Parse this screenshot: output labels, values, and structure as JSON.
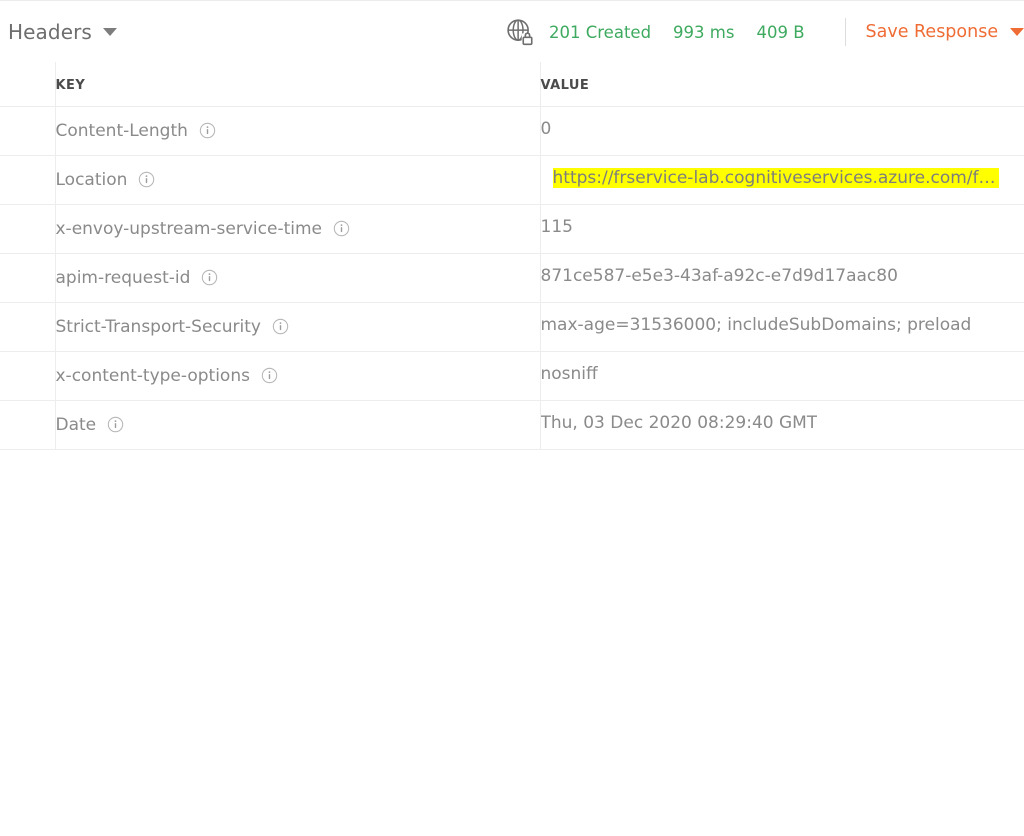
{
  "toolbar": {
    "tab_label": "Headers",
    "tab_caret_icon": "chevron-down-icon",
    "secure_icon": "globe-lock-icon",
    "status_code": "201 Created",
    "response_time": "993 ms",
    "response_size": "409 B",
    "save_response_label": "Save Response",
    "save_caret_icon": "chevron-down-icon",
    "status_color": "#3eaa5f",
    "accent_color": "#ef6c35"
  },
  "table": {
    "columns": [
      "KEY",
      "VALUE"
    ],
    "info_icon": "info-circle-icon",
    "highlight_color": "#ffff00",
    "rows": [
      {
        "key": "Content-Length",
        "value": "0",
        "highlighted": false
      },
      {
        "key": "Location",
        "value": "https://frservice-lab.cognitiveservices.azure.com/f…",
        "highlighted": true
      },
      {
        "key": "x-envoy-upstream-service-time",
        "value": "115",
        "highlighted": false
      },
      {
        "key": "apim-request-id",
        "value": "871ce587-e5e3-43af-a92c-e7d9d17aac80",
        "highlighted": false
      },
      {
        "key": "Strict-Transport-Security",
        "value": "max-age=31536000; includeSubDomains; preload",
        "highlighted": false
      },
      {
        "key": "x-content-type-options",
        "value": "nosniff",
        "highlighted": false
      },
      {
        "key": "Date",
        "value": "Thu, 03 Dec 2020 08:29:40 GMT",
        "highlighted": false
      }
    ]
  }
}
